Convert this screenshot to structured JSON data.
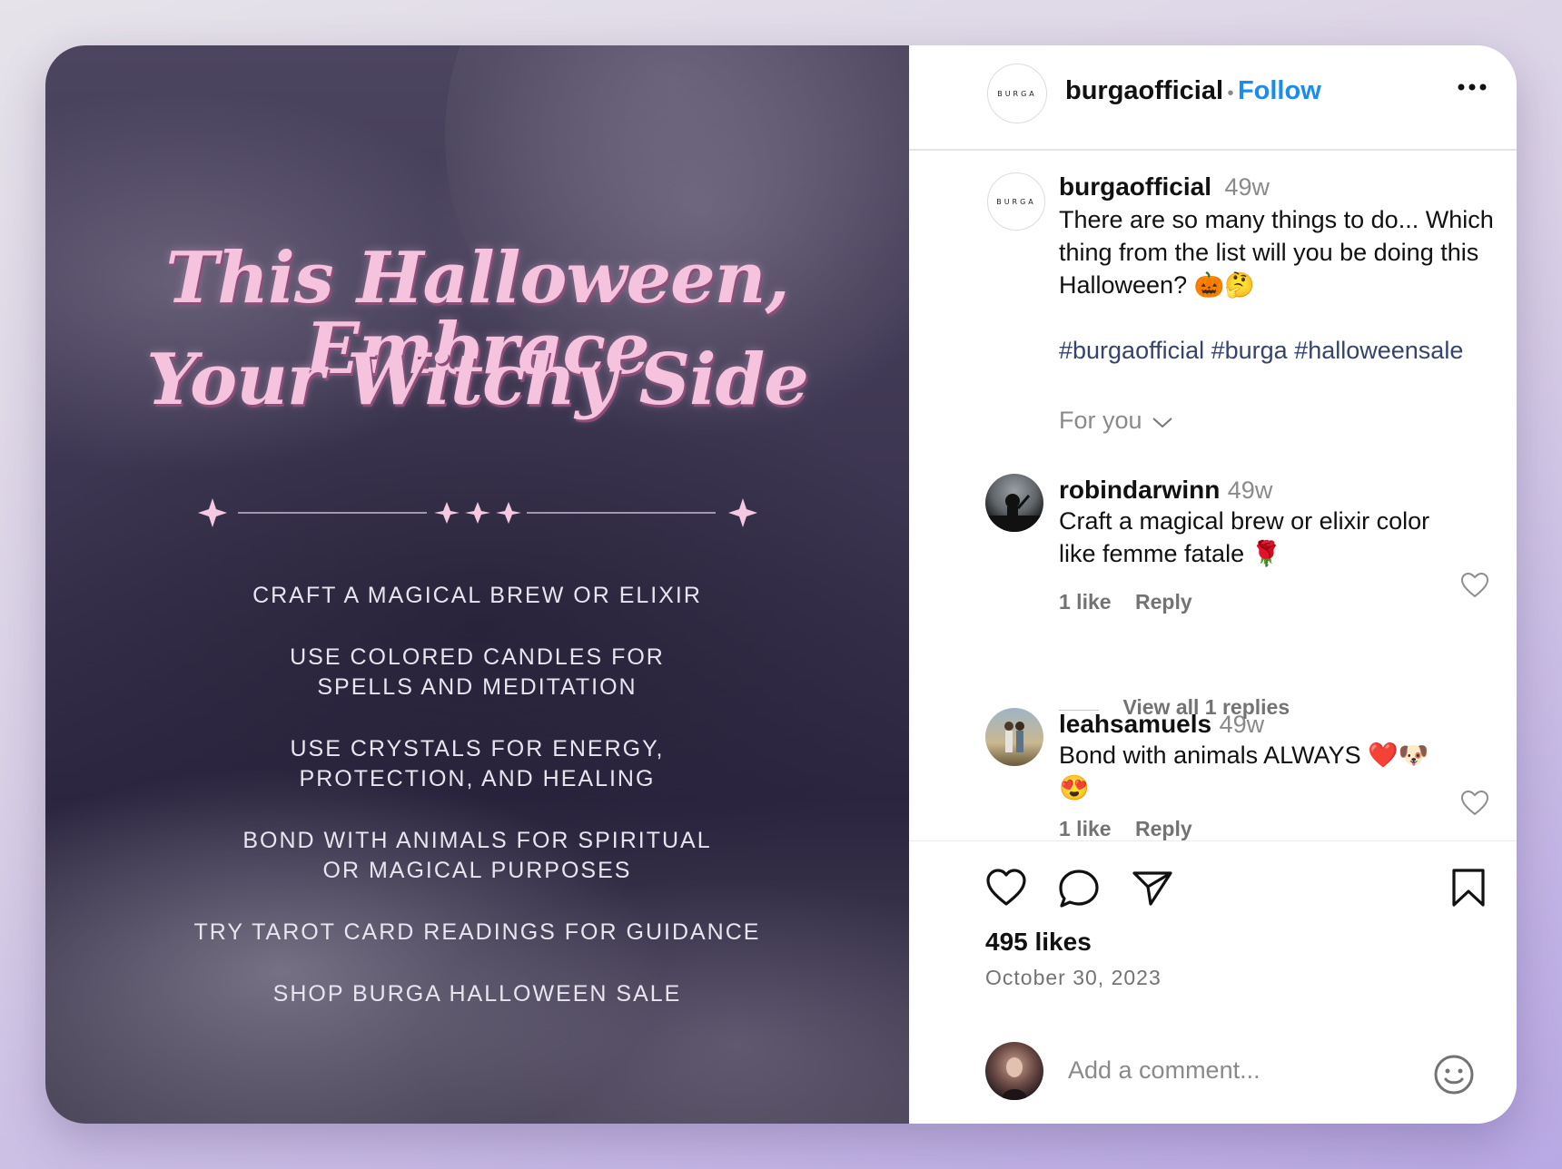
{
  "post_image": {
    "headline_line1": "This Halloween, Embrace",
    "headline_line2": "Your Witchy Side",
    "list": [
      "CRAFT A MAGICAL BREW OR ELIXIR",
      "USE COLORED CANDLES FOR SPELLS AND MEDITATION",
      "USE CRYSTALS FOR ENERGY, PROTECTION, AND HEALING",
      "BOND WITH ANIMALS FOR SPIRITUAL OR MAGICAL PURPOSES",
      "TRY TAROT CARD READINGS FOR GUIDANCE",
      "SHOP BURGA HALLOWEEN SALE"
    ]
  },
  "header": {
    "logo_text": "BURGA",
    "username": "burgaofficial",
    "separator": "•",
    "follow_label": "Follow",
    "more_icon": "more-horizontal-icon"
  },
  "caption": {
    "username": "burgaofficial",
    "time": "49w",
    "text": "There are so many things to do... Which thing from the list will you be doing this Halloween? 🎃🤔",
    "hashtags": "#burgaofficial #burga #halloweensale"
  },
  "for_you_label": "For you",
  "comments": [
    {
      "username": "robindarwinn",
      "time": "49w",
      "text": "Craft a magical brew or elixir color like femme fatale 🌹",
      "likes": "1 like",
      "reply": "Reply",
      "view_replies": "View all 1 replies"
    },
    {
      "username": "leahsamuels",
      "time": "49w",
      "text": "Bond with animals ALWAYS ❤️🐶😍",
      "likes": "1 like",
      "reply": "Reply"
    }
  ],
  "actions": {
    "like_icon": "heart-icon",
    "comment_icon": "comment-icon",
    "share_icon": "send-icon",
    "save_icon": "bookmark-icon"
  },
  "likes": "495 likes",
  "date": "October 30, 2023",
  "add_comment": {
    "placeholder": "Add a comment...",
    "emoji_icon": "emoji-icon"
  },
  "colors": {
    "accent": "#1a8cf0",
    "headline_pink": "#f6c3df",
    "hashtag": "#36436d"
  }
}
